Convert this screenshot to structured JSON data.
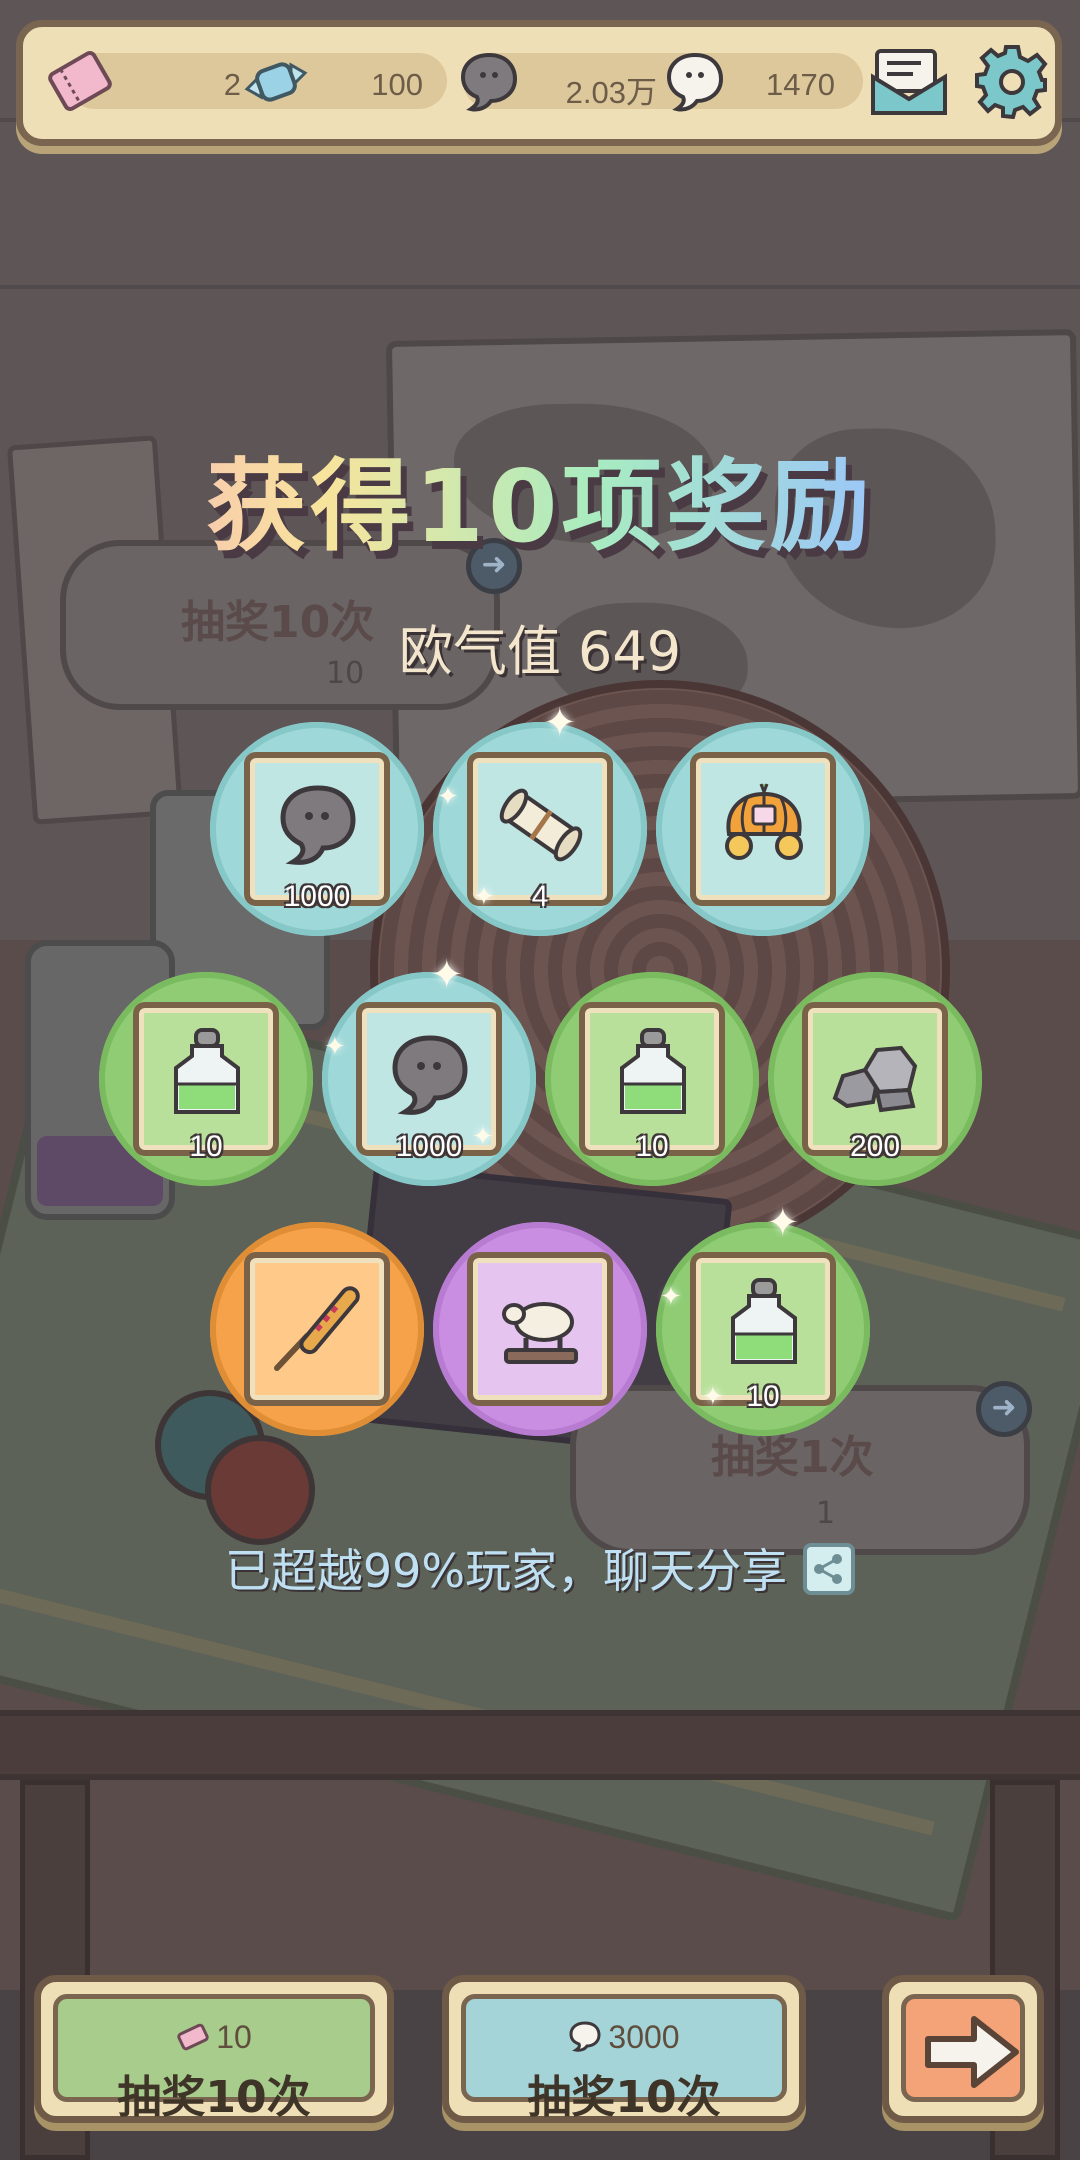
{
  "topbar": {
    "resources": [
      {
        "icon": "ticket-icon",
        "value": "2"
      },
      {
        "icon": "candy-icon",
        "value": "100"
      },
      {
        "icon": "dark-bubble-icon",
        "value": "2.03万"
      },
      {
        "icon": "white-bubble-icon",
        "value": "1470"
      }
    ],
    "mail_icon": "mail-icon",
    "settings_icon": "gear-icon"
  },
  "background": {
    "draw10": {
      "title": "抽奖10次",
      "cost": "10"
    },
    "draw1": {
      "title": "抽奖1次",
      "cost": "1"
    }
  },
  "popup": {
    "title": "获得10项奖励",
    "luck": "欧气值 649",
    "share_text": "已超越99%玩家，聊天分享",
    "rewards": [
      {
        "icon": "dark-bubble-icon",
        "count": "1000",
        "color": "cyan"
      },
      {
        "icon": "scroll-icon",
        "count": "4",
        "color": "cyan"
      },
      {
        "icon": "pumpkin-carriage-icon",
        "count": "",
        "color": "cyan"
      },
      {
        "icon": "potion-bottle-icon",
        "count": "10",
        "color": "green"
      },
      {
        "icon": "dark-bubble-icon",
        "count": "1000",
        "color": "cyan"
      },
      {
        "icon": "potion-bottle-icon",
        "count": "10",
        "color": "green"
      },
      {
        "icon": "stones-icon",
        "count": "200",
        "color": "green"
      },
      {
        "icon": "corndog-icon",
        "count": "",
        "color": "orange"
      },
      {
        "icon": "sheep-statue-icon",
        "count": "",
        "color": "purple"
      },
      {
        "icon": "potion-bottle-icon",
        "count": "10",
        "color": "green"
      }
    ]
  },
  "buttons": {
    "draw_ticket": {
      "cost": "10",
      "label": "抽奖10次"
    },
    "draw_bubble": {
      "cost": "3000",
      "label": "抽奖10次"
    },
    "next_icon": "arrow-right-icon"
  }
}
